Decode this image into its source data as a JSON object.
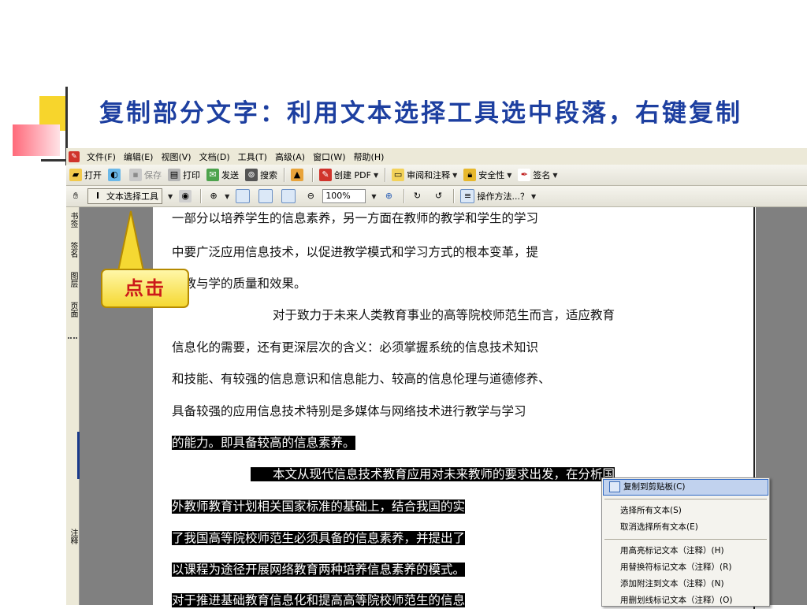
{
  "slide": {
    "title": "复制部分文字：利用文本选择工具选中段落，右键复制",
    "callout": "点击"
  },
  "menubar": {
    "items": [
      "文件(F)",
      "编辑(E)",
      "视图(V)",
      "文档(D)",
      "工具(T)",
      "高级(A)",
      "窗口(W)",
      "帮助(H)"
    ]
  },
  "toolbar1": {
    "open": "打开",
    "save": "保存",
    "print": "打印",
    "send": "发送",
    "search": "搜索",
    "create_pdf": "创建 PDF",
    "review": "审阅和注释",
    "security": "安全性",
    "sign": "签名"
  },
  "toolbar2": {
    "text_select_tool": "文本选择工具",
    "zoom": "100%",
    "how_to": "操作方法...？"
  },
  "side_tabs": [
    "书签",
    "签名",
    "图层",
    "页面",
    "注释"
  ],
  "document": {
    "lines": [
      "一部分以培养学生的信息素养，另一方面在教师的教学和学生的学习",
      "中要广泛应用信息技术，以促进教学模式和学习方式的根本变革，提",
      "高教与学的质量和效果。",
      "对于致力于未来人类教育事业的高等院校师范生而言，适应教育",
      "信息化的需要，还有更深层次的含义：必须掌握系统的信息技术知识",
      "和技能、有较强的信息意识和信息能力、较高的信息伦理与道德修养、",
      "具备较强的应用信息技术特别是多媒体与网络技术进行教学与学习",
      "的能力。即具备较高的信息素养。",
      "本文从现代信息技术教育应用对未来教师的要求出发，在分析国",
      "外教师教育计划相关国家标准的基础上，结合我国的实",
      "了我国高等院校师范生必须具备的信息素养，并提出了",
      "以课程为途径开展网络教育两种培养信息素养的模式。",
      "对于推进基础教育信息化和提高高等院校师范生的信息"
    ]
  },
  "context_menu": {
    "items": [
      "复制到剪贴板(C)",
      "选择所有文本(S)",
      "取消选择所有文本(E)",
      "用高亮标记文本（注释）(H)",
      "用替换符标记文本（注释）(R)",
      "添加附注到文本（注释）(N)",
      "用删划线标记文本（注释）(O)"
    ]
  }
}
